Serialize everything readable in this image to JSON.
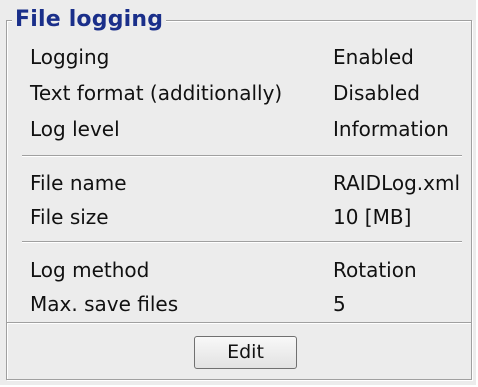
{
  "group": {
    "title": "File logging"
  },
  "section_general": {
    "logging": {
      "label": "Logging",
      "value": "Enabled"
    },
    "text_format": {
      "label": "Text format (additionally)",
      "value": "Disabled"
    },
    "log_level": {
      "label": "Log level",
      "value": "Information"
    }
  },
  "section_file": {
    "file_name": {
      "label": "File name",
      "value": "RAIDLog.xml"
    },
    "file_size": {
      "label": "File size",
      "value": "10 [MB]"
    }
  },
  "section_method": {
    "log_method": {
      "label": "Log method",
      "value": "Rotation"
    },
    "max_save_files": {
      "label": "Max. save files",
      "value": "5"
    }
  },
  "actions": {
    "edit_label": "Edit"
  }
}
